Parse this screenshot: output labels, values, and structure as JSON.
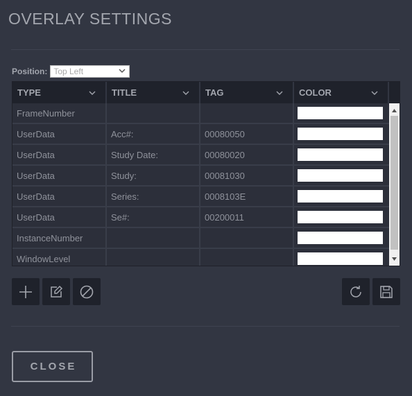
{
  "dialog": {
    "title": "OVERLAY SETTINGS"
  },
  "position": {
    "label": "Position:",
    "selected": "Top Left"
  },
  "table": {
    "columns": [
      "TYPE",
      "TITLE",
      "TAG",
      "COLOR"
    ],
    "rows": [
      {
        "type": "FrameNumber",
        "title": "",
        "tag": "",
        "color": "#ffffff"
      },
      {
        "type": "UserData",
        "title": "Acc#:",
        "tag": "00080050",
        "color": "#ffffff"
      },
      {
        "type": "UserData",
        "title": "Study Date:",
        "tag": "00080020",
        "color": "#ffffff"
      },
      {
        "type": "UserData",
        "title": "Study:",
        "tag": "00081030",
        "color": "#ffffff"
      },
      {
        "type": "UserData",
        "title": "Series:",
        "tag": "0008103E",
        "color": "#ffffff"
      },
      {
        "type": "UserData",
        "title": "Se#:",
        "tag": "00200011",
        "color": "#ffffff"
      },
      {
        "type": "InstanceNumber",
        "title": "",
        "tag": "",
        "color": "#ffffff"
      },
      {
        "type": "WindowLevel",
        "title": "",
        "tag": "",
        "color": "#ffffff"
      }
    ]
  },
  "toolbar": {
    "left": [
      "plus-icon",
      "edit-icon",
      "disable-icon"
    ],
    "right": [
      "refresh-icon",
      "save-icon"
    ]
  },
  "footer": {
    "close_label": "CLOSE"
  },
  "colors": {
    "background": "#323642",
    "header": "#1f222b",
    "text": "#9a9da6"
  }
}
